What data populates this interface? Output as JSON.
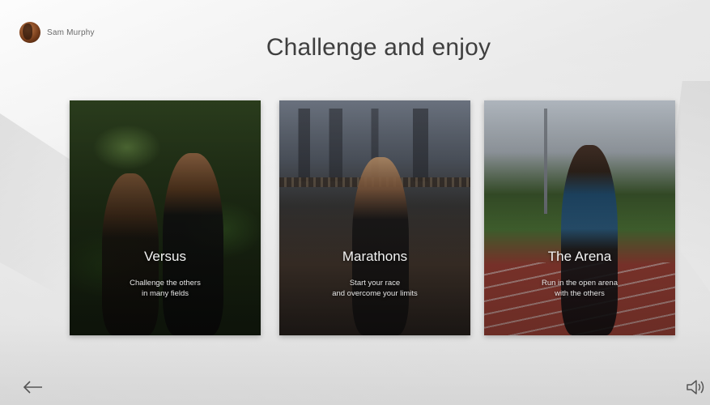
{
  "user": {
    "name": "Sam Murphy"
  },
  "header": {
    "title": "Challenge and enjoy"
  },
  "cards": [
    {
      "title": "Versus",
      "description": "Challenge the others\nin many fields"
    },
    {
      "title": "Marathons",
      "description": "Start your race\nand overcome your limits"
    },
    {
      "title": "The Arena",
      "description": "Run in the open arena\nwith the others"
    }
  ],
  "footer": {
    "back_icon": "arrow-left-icon",
    "sound_icon": "speaker-icon"
  }
}
